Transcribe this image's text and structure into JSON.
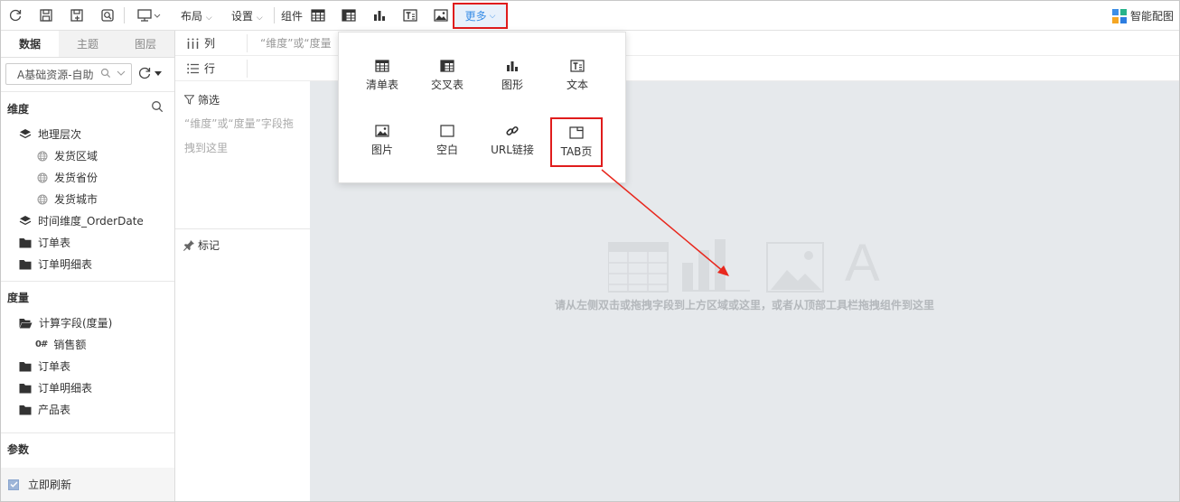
{
  "toolbar": {
    "layout_label": "布局",
    "settings_label": "设置",
    "component_label": "组件",
    "more_label": "更多",
    "smart_label": "智能配图",
    "smart_colors": [
      "#3d8ee6",
      "#27b38b",
      "#f5a623",
      "#2d7de0"
    ]
  },
  "left": {
    "tabs": [
      "数据",
      "主题",
      "图层"
    ],
    "datasource": "A基础资源-自助",
    "dimension_title": "维度",
    "dimensions": [
      {
        "label": "地理层次",
        "icon": "layers-icon",
        "level": 0
      },
      {
        "label": "发货区域",
        "icon": "globe-icon",
        "level": 1
      },
      {
        "label": "发货省份",
        "icon": "globe-icon",
        "level": 1
      },
      {
        "label": "发货城市",
        "icon": "globe-icon",
        "level": 1
      },
      {
        "label": "时间维度_OrderDate",
        "icon": "layers-icon",
        "level": 0
      },
      {
        "label": "订单表",
        "icon": "folder-icon",
        "level": 0
      },
      {
        "label": "订单明细表",
        "icon": "folder-icon",
        "level": 0
      }
    ],
    "measure_title": "度量",
    "measures": [
      {
        "label": "计算字段(度量)",
        "icon": "folder-open-icon",
        "level": 0
      },
      {
        "label": "销售额",
        "icon": "number-icon",
        "level": 1
      },
      {
        "label": "订单表",
        "icon": "folder-icon",
        "level": 0
      },
      {
        "label": "订单明细表",
        "icon": "folder-icon",
        "level": 0
      },
      {
        "label": "产品表",
        "icon": "folder-icon",
        "level": 0
      }
    ],
    "param_title": "参数",
    "refresh_label": "立即刷新"
  },
  "mid": {
    "column_label": "列",
    "row_label": "行",
    "column_hint": "“维度”或“度量",
    "filter_label": "筛选",
    "filter_hint": "“维度”或“度量”字段拖拽到这里",
    "mark_label": "标记"
  },
  "canvas": {
    "hint": "请从左侧双击或拖拽字段到上方区域或这里，或者从顶部工具栏拖拽组件到这里"
  },
  "dropdown": {
    "items": [
      {
        "label": "清单表",
        "icon": "list-table-icon"
      },
      {
        "label": "交叉表",
        "icon": "cross-table-icon"
      },
      {
        "label": "图形",
        "icon": "chart-icon"
      },
      {
        "label": "文本",
        "icon": "text-icon"
      },
      {
        "label": "图片",
        "icon": "image-icon"
      },
      {
        "label": "空白",
        "icon": "blank-icon"
      },
      {
        "label": "URL链接",
        "icon": "link-icon"
      },
      {
        "label": "TAB页",
        "icon": "tab-icon"
      }
    ]
  }
}
